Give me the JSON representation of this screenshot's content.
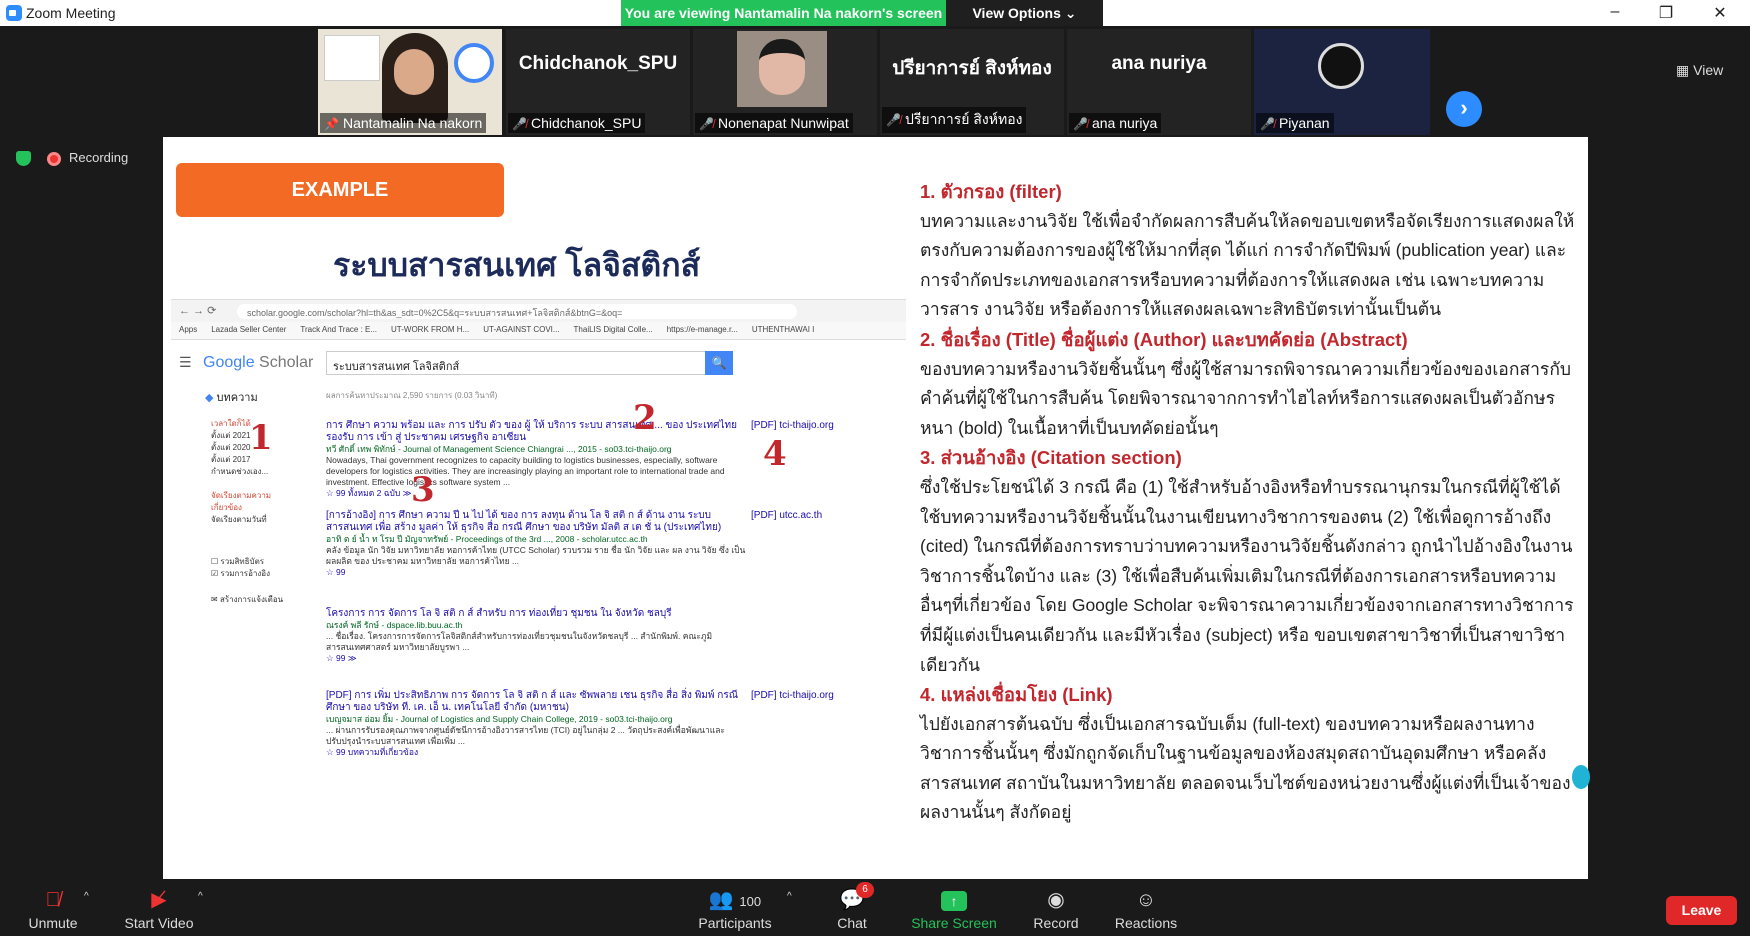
{
  "window": {
    "title": "Zoom Meeting",
    "minimize": "–",
    "restore": "❐",
    "close": "✕"
  },
  "banner": {
    "message": "You are viewing Nantamalin Na nakorn's screen",
    "view_options": "View Options ⌄"
  },
  "participants_strip": [
    {
      "label": "Nantamalin Na nakorn",
      "display": "",
      "pinned": true
    },
    {
      "label": "Chidchanok_SPU",
      "display": "Chidchanok_SPU"
    },
    {
      "label": "Nonenapat Nunwipat",
      "display": ""
    },
    {
      "label": "ปรียาการย์ สิงห์ทอง",
      "display": "ปรียาการย์ สิงห์ทอง"
    },
    {
      "label": "ana nuriya",
      "display": "ana nuriya"
    },
    {
      "label": "Piyanan",
      "display": ""
    }
  ],
  "view_button": "View",
  "recording_label": "Recording",
  "slide": {
    "example": "EXAMPLE",
    "title": "ระบบสารสนเทศ โลจิสติกส์",
    "scholar": {
      "url": "scholar.google.com/scholar?hl=th&as_sdt=0%2C5&q=ระบบสารสนเทศ+โลจิสติกส์&btnG=&oq=",
      "bookmarks": [
        "Apps",
        "Lazada Seller Center",
        "Track And Trace : E...",
        "UT-WORK FROM H...",
        "UT-AGAINST COVI...",
        "ThaiLIS Digital Colle...",
        "https://e-manage.r...",
        "UTHENTHAWAI I"
      ],
      "logo_google": "Google",
      "logo_scholar": "Scholar",
      "query": "ระบบสารสนเทศ โลจิสติกส์",
      "search_icon": "🔍",
      "tab": "บทความ",
      "stats": "ผลการค้นหาประมาณ 2,590 รายการ (0.03 วินาที)",
      "side": [
        "เวลาใดก็ได้",
        "ตั้งแต่ 2021",
        "ตั้งแต่ 2020",
        "ตั้งแต่ 2017",
        "กำหนดช่วงเอง...",
        "",
        "จัดเรียงตามความเกี่ยวข้อง",
        "จัดเรียงตามวันที่",
        "",
        "รวมสิทธิบัตร",
        "รวมการอ้างอิง",
        "",
        "สร้างการแจ้งเตือน"
      ],
      "results": [
        {
          "title": "การ ศึกษา ความ พร้อม และ การ ปรับ ตัว ของ ผู้ ให้ บริการ ระบบ สารสนเทศ ... ของ ประเทศไทย รองรับ การ เข้า สู่ ประชาคม เศรษฐกิจ อาเซียน",
          "src": "ทวี ศักดิ์ เทพ พิทักษ์ - Journal of Management Science Chiangrai ..., 2015 - so03.tci-thaijo.org",
          "snip": "Nowadays, Thai government recognizes to capacity building to logistics businesses, especially, software developers for logistics activities. They are increasingly playing an important role to international trade and investment. Effective logistics software system ...",
          "links": "☆ 99 ทั้งหมด 2 ฉบับ ≫",
          "pdf": "[PDF] tci-thaijo.org"
        },
        {
          "title": "[การอ้างอิง] การ ศึกษา ความ ปี น ไป ได้ ของ การ ลงทุน ด้าน โล จิ สติ ก ส์ ด้าน งาน ระบบ สารสนเทศ เพื่อ สร้าง มูลค่า ให้ ธุรกิจ สื่อ กรณี ศึกษา ของ บริษัท มัลติ ส เต ชั่ น (ประเทศไทย)",
          "src": "อาทิ ต ย์ น้ำ ท โรม ปี มัญจาทรัพย์ - Proceedings of the 3rd ..., 2008 - scholar.utcc.ac.th",
          "snip": "คลัง ข้อมูล นัก วิจัย มหาวิทยาลัย หอการค้าไทย (UTCC Scholar) รวบรวม ราย ชื่อ นัก วิจัย และ ผล งาน วิจัย ซึ่ง เป็น ผลผลิต ของ ประชาคม มหาวิทยาลัย หอการค้าไทย ...",
          "links": "☆ 99",
          "pdf": "[PDF] utcc.ac.th"
        },
        {
          "title": "โครงการ การ จัดการ โล จิ สติ ก ส์ สำหรับ การ ท่องเที่ยว ชุมชน ใน จังหวัด ชลบุรี",
          "src": "ณรงค์ พลี รักษ์ - dspace.lib.buu.ac.th",
          "snip": "... ชื่อเรื่อง. โครงการการจัดการโลจิสติกส์สำหรับการท่องเที่ยวชุมชนในจังหวัดชลบุรี ... สำนักพิมพ์. คณะภูมิสารสนเทศศาสตร์ มหาวิทยาลัยบูรพา ...",
          "links": "☆ 99 ≫",
          "pdf": ""
        },
        {
          "title": "[PDF] การ เพิ่ม ประสิทธิภาพ การ จัดการ โล จิ สติ ก ส์ และ ซัพพลาย เชน ธุรกิจ สื่อ สิ่ง พิมพ์ กรณี ศึกษา ของ บริษัท ที. เค. เอ็ น. เทคโนโลยี จำกัด (มหาชน)",
          "src": "เบญจมาส อ่อม ยิ้ม - Journal of Logistics and Supply Chain College, 2019 - so03.tci-thaijo.org",
          "snip": "... ผ่านการรับรองคุณภาพจากศูนย์ดัชนีการอ้างอิงวารสารไทย (TCI) อยู่ในกลุ่ม 2 ... วัตถุประสงค์เพื่อพัฒนาและปรับปรุงนำระบบสารสนเทศ เพื่อเพิ่ม ...",
          "links": "☆ 99 บทความที่เกี่ยวข้อง",
          "pdf": "[PDF] tci-thaijo.org"
        }
      ]
    },
    "annotations": [
      "1",
      "2",
      "3",
      "4"
    ],
    "sections": [
      {
        "heading": "1. ตัวกรอง (filter)",
        "body": "บทความและงานวิจัย ใช้เพื่อจำกัดผลการสืบค้นให้ลดขอบเขตหรือจัดเรียงการแสดงผลให้ตรงกับความต้องการของผู้ใช้ให้มากที่สุด ได้แก่ การจำกัดปีพิมพ์ (publication year) และการจำกัดประเภทของเอกสารหรือบทความที่ต้องการให้แสดงผล เช่น เฉพาะบทความวารสาร งานวิจัย หรือต้องการให้แสดงผลเฉพาะสิทธิบัตรเท่านั้นเป็นต้น"
      },
      {
        "heading": "2. ชื่อเรื่อง (Title) ชื่อผู้แต่ง (Author) และบทคัดย่อ (Abstract)",
        "body": "ของบทความหรืองานวิจัยชิ้นนั้นๆ ซึ่งผู้ใช้สามารถพิจารณาความเกี่ยวข้องของเอกสารกับคำค้นที่ผู้ใช้ในการสืบค้น โดยพิจารณาจากการทำไฮไลท์หรือการแสดงผลเป็นตัวอักษรหนา (bold) ในเนื้อหาที่เป็นบทคัดย่อนั้นๆ"
      },
      {
        "heading": "3. ส่วนอ้างอิง (Citation section)",
        "body": "ซึ่งใช้ประโยชน์ได้ 3 กรณี คือ (1) ใช้สำหรับอ้างอิงหรือทำบรรณานุกรมในกรณีที่ผู้ใช้ได้ใช้บทความหรืองานวิจัยชิ้นนั้นในงานเขียนทางวิชาการของตน (2) ใช้เพื่อดูการอ้างถึง (cited) ในกรณีที่ต้องการทราบว่าบทความหรืองานวิจัยชิ้นดังกล่าว ถูกนำไปอ้างอิงในงานวิชาการชิ้นใดบ้าง และ (3) ใช้เพื่อสืบค้นเพิ่มเติมในกรณีที่ต้องการเอกสารหรือบทความอื่นๆที่เกี่ยวข้อง โดย Google Scholar จะพิจารณาความเกี่ยวข้องจากเอกสารทางวิชาการที่มีผู้แต่งเป็นคนเดียวกัน และมีหัวเรื่อง (subject) หรือ ขอบเขตสาขาวิชาที่เป็นสาขาวิชาเดียวกัน"
      },
      {
        "heading": "4. แหล่งเชื่อมโยง (Link)",
        "body": "ไปยังเอกสารต้นฉบับ ซึ่งเป็นเอกสารฉบับเต็ม (full-text) ของบทความหรือผลงานทางวิชาการชิ้นนั้นๆ ซึ่งมักถูกจัดเก็บในฐานข้อมูลของห้องสมุดสถาบันอุดมศึกษา หรือคลังสารสนเทศ สถาบันในมหาวิทยาลัย ตลอดจนเว็บไซต์ของหน่วยงานซึ่งผู้แต่งที่เป็นเจ้าของผลงานนั้นๆ สังกัดอยู่"
      }
    ]
  },
  "toolbar": {
    "unmute": "Unmute",
    "start_video": "Start Video",
    "participants": "Participants",
    "participants_count": "100",
    "chat": "Chat",
    "chat_badge": "6",
    "share": "Share Screen",
    "record": "Record",
    "reactions": "Reactions",
    "leave": "Leave"
  }
}
